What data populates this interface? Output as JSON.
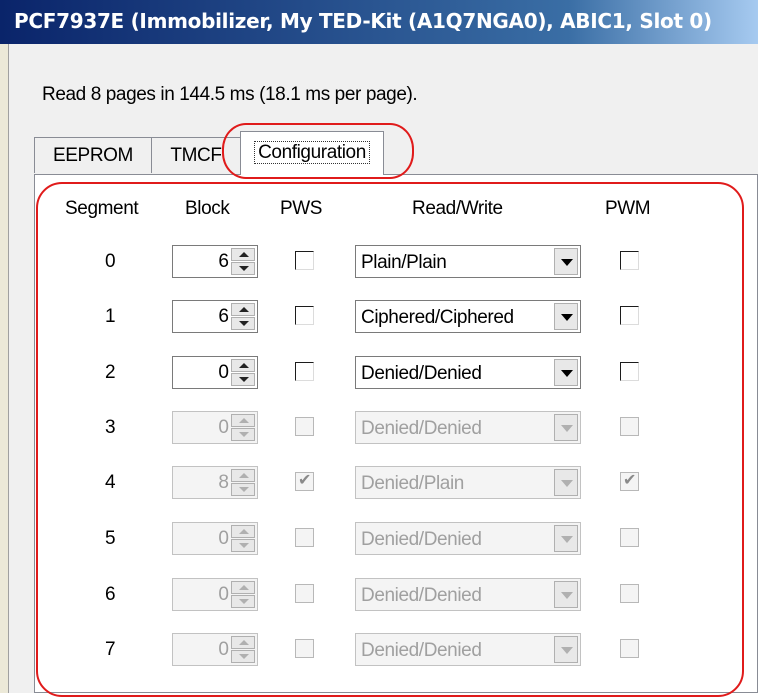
{
  "window": {
    "title": "PCF7937E (Immobilizer, My TED-Kit (A1Q7NGA0), ABIC1, Slot 0)"
  },
  "status_text": "Read 8 pages in 144.5 ms (18.1 ms per page).",
  "tabs": [
    {
      "label": "EEPROM",
      "selected": false
    },
    {
      "label": "TMCF",
      "selected": false
    },
    {
      "label": "Configuration",
      "selected": true
    }
  ],
  "columns": {
    "segment": "Segment",
    "block": "Block",
    "pws": "PWS",
    "read_write": "Read/Write",
    "pwm": "PWM"
  },
  "rows": [
    {
      "segment": "0",
      "block": "6",
      "pws": false,
      "read_write": "Plain/Plain",
      "pwm": false,
      "enabled": true
    },
    {
      "segment": "1",
      "block": "6",
      "pws": false,
      "read_write": "Ciphered/Ciphered",
      "pwm": false,
      "enabled": true
    },
    {
      "segment": "2",
      "block": "0",
      "pws": false,
      "read_write": "Denied/Denied",
      "pwm": false,
      "enabled": true
    },
    {
      "segment": "3",
      "block": "0",
      "pws": false,
      "read_write": "Denied/Denied",
      "pwm": false,
      "enabled": false
    },
    {
      "segment": "4",
      "block": "8",
      "pws": true,
      "read_write": "Denied/Plain",
      "pwm": true,
      "enabled": false
    },
    {
      "segment": "5",
      "block": "0",
      "pws": false,
      "read_write": "Denied/Denied",
      "pwm": false,
      "enabled": false
    },
    {
      "segment": "6",
      "block": "0",
      "pws": false,
      "read_write": "Denied/Denied",
      "pwm": false,
      "enabled": false
    },
    {
      "segment": "7",
      "block": "0",
      "pws": false,
      "read_write": "Denied/Denied",
      "pwm": false,
      "enabled": false
    }
  ],
  "colors": {
    "title_gradient_start": "#0a246a",
    "annotation": "#e01b1b",
    "disabled_text": "#a0a0a0"
  }
}
